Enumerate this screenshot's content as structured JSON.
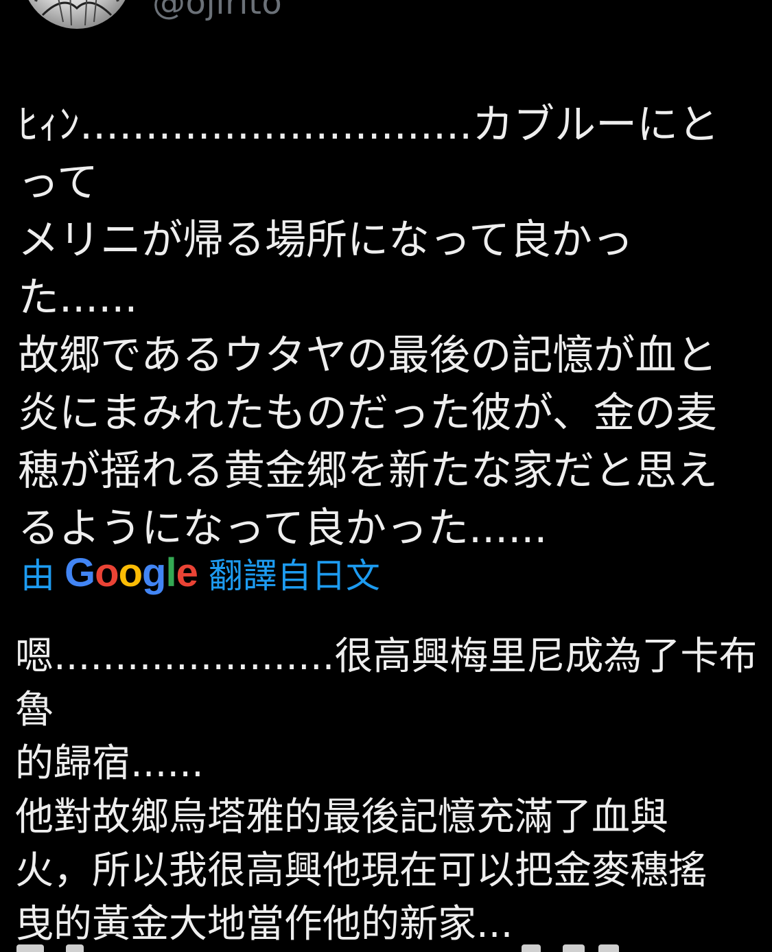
{
  "author": {
    "handle": "@ojirito"
  },
  "tweet": {
    "text": "ﾋｨﾝ..............................カブルーにとって\nメリニが帰る場所になって良かっ\nた......\n故郷であるウタヤの最後の記憶が血と\n炎にまみれたものだった彼が、金の麦\n穂が揺れる黄金郷を新たな家だと思え\nるようになって良かった......"
  },
  "translation": {
    "by_label": "由",
    "provider_letters": [
      "G",
      "o",
      "o",
      "g",
      "l",
      "e"
    ],
    "provider_colors": [
      "#4285F4",
      "#EA4335",
      "#FBBC05",
      "#4285F4",
      "#34A853",
      "#EA4335"
    ],
    "from_label": "翻譯自日文",
    "link_color": "#1d9bf0",
    "text": "嗯.......................很高興梅里尼成為了卡布魯\n的歸宿......\n他對故鄉烏塔雅的最後記憶充滿了血與\n火，所以我很高興他現在可以把金麥穗搖\n曳的黃金大地當作他的新家..."
  }
}
